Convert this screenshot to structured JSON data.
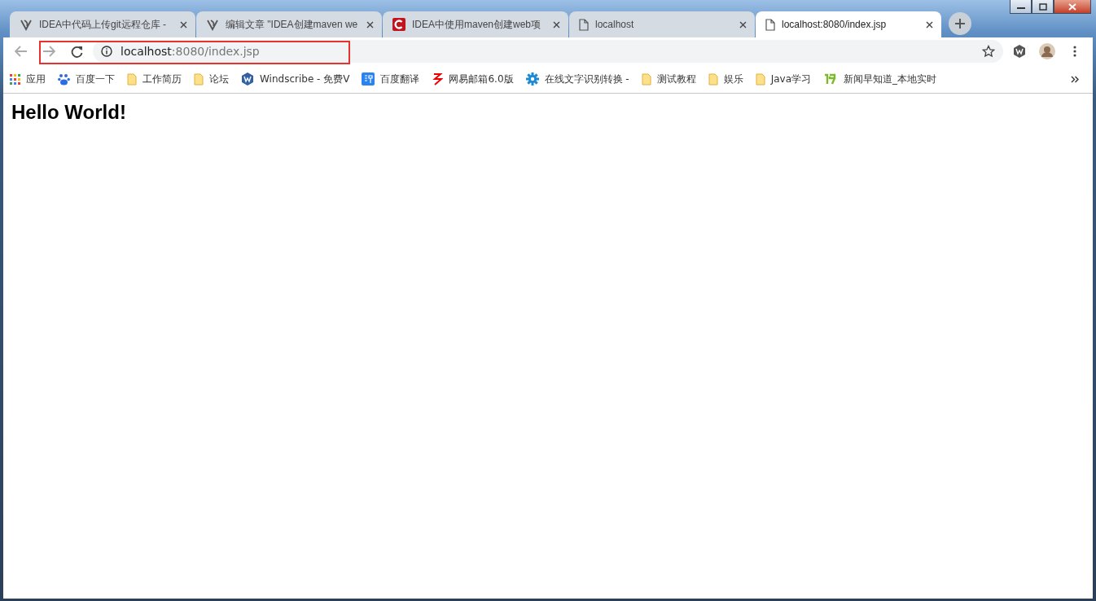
{
  "tabs": [
    {
      "kind": "idea",
      "title": "IDEA中代码上传git远程仓库 -",
      "selected": false
    },
    {
      "kind": "idea",
      "title": "编辑文章 \"IDEA创建maven we",
      "selected": false
    },
    {
      "kind": "csdn",
      "title": "IDEA中使用maven创建web项",
      "selected": false
    },
    {
      "kind": "page",
      "title": "localhost",
      "selected": false
    },
    {
      "kind": "page",
      "title": "localhost:8080/index.jsp",
      "selected": true
    }
  ],
  "address": {
    "host": "localhost",
    "path": ":8080/index.jsp",
    "highlighted": true
  },
  "bookmarks": [
    {
      "kind": "apps",
      "label": "应用"
    },
    {
      "kind": "paw",
      "label": "百度一下"
    },
    {
      "kind": "folder",
      "label": "工作简历"
    },
    {
      "kind": "folder",
      "label": "论坛"
    },
    {
      "kind": "wbadge",
      "label": "Windscribe - 免费V"
    },
    {
      "kind": "translate",
      "label": "百度翻译"
    },
    {
      "kind": "mail",
      "label": "网易邮箱6.0版"
    },
    {
      "kind": "gear",
      "label": "在线文字识别转换 -"
    },
    {
      "kind": "folder",
      "label": "测试教程"
    },
    {
      "kind": "folder",
      "label": "娱乐"
    },
    {
      "kind": "folder",
      "label": "Java学习"
    },
    {
      "kind": "news",
      "label": "新闻早知道_本地实时"
    }
  ],
  "page": {
    "heading": "Hello World!"
  }
}
